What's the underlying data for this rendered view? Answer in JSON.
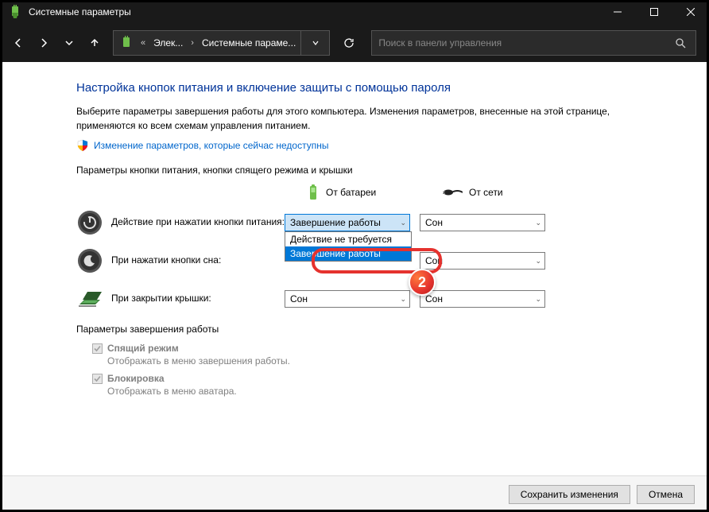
{
  "window": {
    "title": "Системные параметры"
  },
  "breadcrumb": {
    "prefix": "«",
    "item1": "Элек...",
    "item2": "Системные параме..."
  },
  "search": {
    "placeholder": "Поиск в панели управления"
  },
  "page": {
    "title": "Настройка кнопок питания и включение защиты с помощью пароля",
    "desc": "Выберите параметры завершения работы для этого компьютера. Изменения параметров, внесенные на этой странице, применяются ко всем схемам управления питанием.",
    "shield_link": "Изменение параметров, которые сейчас недоступны"
  },
  "buttons_section": {
    "title": "Параметры кнопки питания, кнопки спящего режима и крышки",
    "col_battery": "От батареи",
    "col_ac": "От сети",
    "row_power": "Действие при нажатии кнопки питания:",
    "row_sleep": "При нажатии кнопки сна:",
    "row_lid": "При закрытии крышки:",
    "val_shutdown": "Завершение работы",
    "val_sleep": "Сон",
    "option_none": "Действие не требуется",
    "option_shutdown": "Завершение работы"
  },
  "shutdown_section": {
    "title": "Параметры завершения работы",
    "sleep_label": "Спящий режим",
    "sleep_desc": "Отображать в меню завершения работы.",
    "lock_label": "Блокировка",
    "lock_desc": "Отображать в меню аватара."
  },
  "footer": {
    "save": "Сохранить изменения",
    "cancel": "Отмена"
  },
  "badge": "2"
}
